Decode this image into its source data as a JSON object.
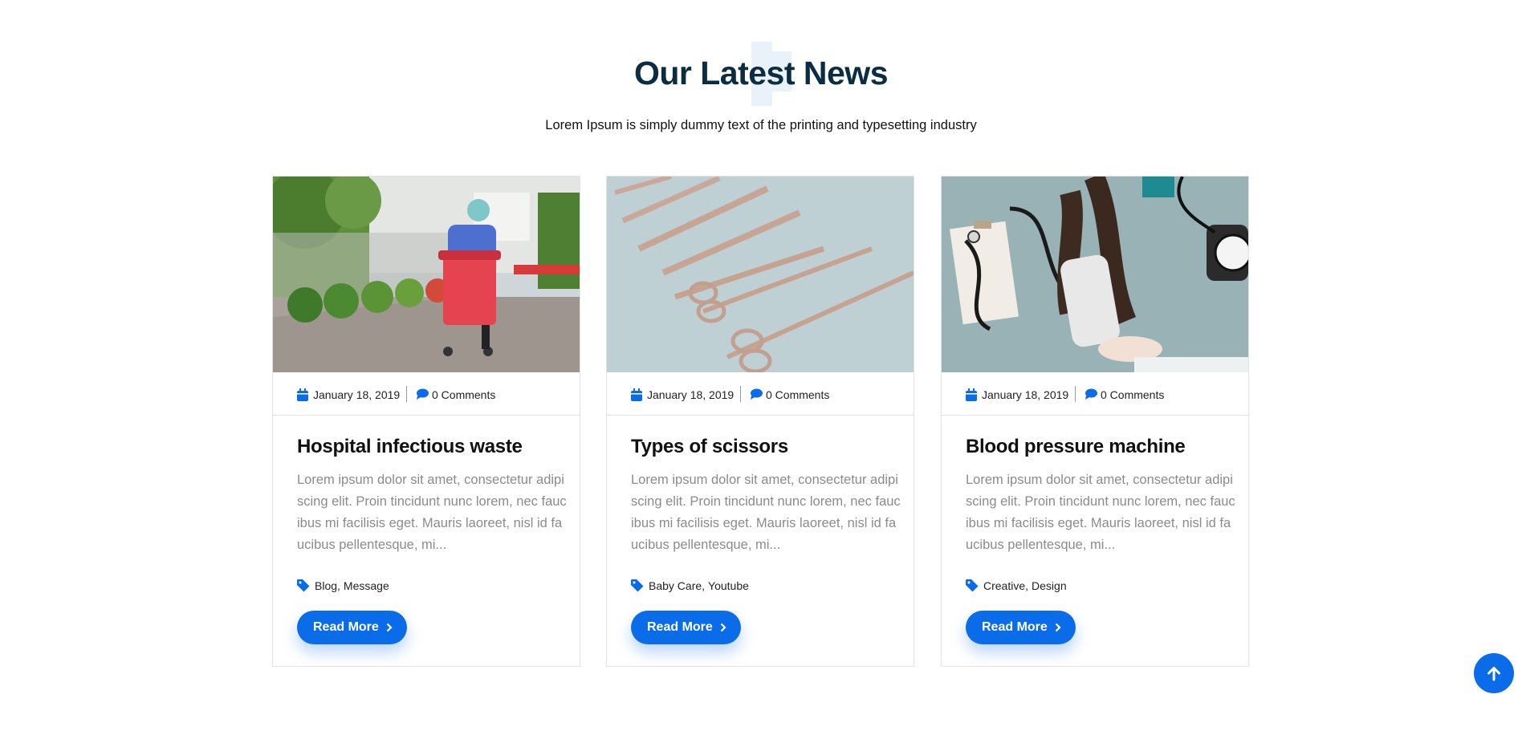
{
  "section": {
    "title": "Our Latest News",
    "subtitle": "Lorem Ipsum is simply dummy text of the printing and typesetting industry"
  },
  "colors": {
    "accent": "#0b6cea",
    "heading": "#0a2d42",
    "excerpt_text": "#8b8b8b",
    "card_border": "#e3e3e3",
    "decor": "#e9f1fa"
  },
  "posts": [
    {
      "image": "hospital-worker-with-red-waste-bin-photo",
      "date": "January 18, 2019",
      "comments": "0 Comments",
      "title": "Hospital infectious waste",
      "excerpt": "Lorem ipsum dolor sit amet, consectetur adipiscing elit. Proin tincidunt nunc lorem, nec faucibus mi facilisis eget. Mauris laoreet, nisl id faucibus pellentesque, mi...",
      "tags": [
        "Blog",
        "Message"
      ],
      "button": "Read More"
    },
    {
      "image": "surgical-scissors-and-scalpels-photo",
      "date": "January 18, 2019",
      "comments": "0 Comments",
      "title": "Types of scissors",
      "excerpt": "Lorem ipsum dolor sit amet, consectetur adipiscing elit. Proin tincidunt nunc lorem, nec faucibus mi facilisis eget. Mauris laoreet, nisl id faucibus pellentesque, mi...",
      "tags": [
        "Baby Care",
        "Youtube"
      ],
      "button": "Read More"
    },
    {
      "image": "doctor-measuring-blood-pressure-photo",
      "date": "January 18, 2019",
      "comments": "0 Comments",
      "title": "Blood pressure machine",
      "excerpt": "Lorem ipsum dolor sit amet, consectetur adipiscing elit. Proin tincidunt nunc lorem, nec faucibus mi facilisis eget. Mauris laoreet, nisl id faucibus pellentesque, mi...",
      "tags": [
        "Creative",
        "Design"
      ],
      "button": "Read More"
    }
  ],
  "icons": {
    "date": "calendar-icon",
    "comments": "comment-icon",
    "tags": "tag-icon",
    "read_more": "chevron-right-icon",
    "scroll_top": "arrow-up-icon"
  }
}
